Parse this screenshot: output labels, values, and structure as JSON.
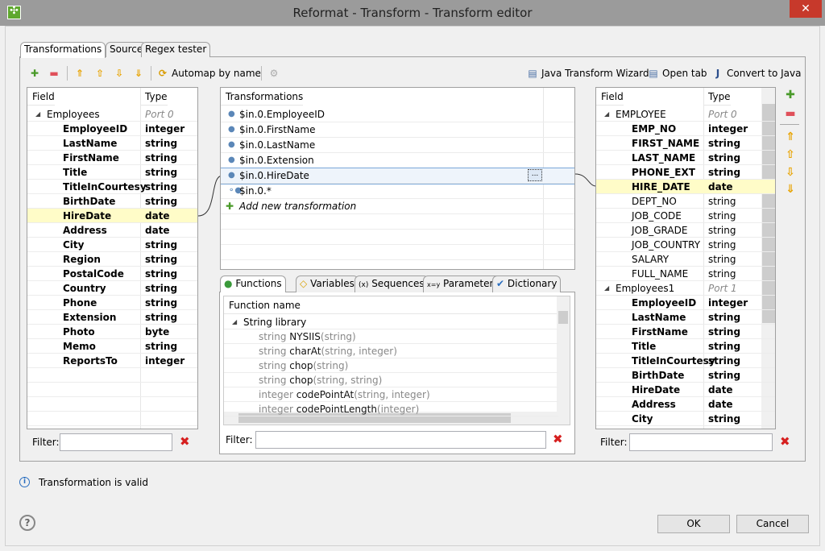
{
  "window": {
    "title": "Reformat - Transform - Transform editor",
    "close": "✕"
  },
  "tabs": [
    "Transformations",
    "Source",
    "Regex tester"
  ],
  "toolbar": {
    "automap": "Automap by name",
    "wizard": "Java Transform Wizard",
    "open_tab": "Open tab",
    "convert": "Convert to Java"
  },
  "source": {
    "col_field": "Field",
    "col_type": "Type",
    "rows": [
      {
        "f": "Employees",
        "t": "Port 0",
        "group": true
      },
      {
        "f": "EmployeeID",
        "t": "integer"
      },
      {
        "f": "LastName",
        "t": "string"
      },
      {
        "f": "FirstName",
        "t": "string"
      },
      {
        "f": "Title",
        "t": "string"
      },
      {
        "f": "TitleInCourtesy",
        "t": "string"
      },
      {
        "f": "BirthDate",
        "t": "string"
      },
      {
        "f": "HireDate",
        "t": "date",
        "hl": true
      },
      {
        "f": "Address",
        "t": "date"
      },
      {
        "f": "City",
        "t": "string"
      },
      {
        "f": "Region",
        "t": "string"
      },
      {
        "f": "PostalCode",
        "t": "string"
      },
      {
        "f": "Country",
        "t": "string"
      },
      {
        "f": "Phone",
        "t": "string"
      },
      {
        "f": "Extension",
        "t": "string"
      },
      {
        "f": "Photo",
        "t": "byte"
      },
      {
        "f": "Memo",
        "t": "string"
      },
      {
        "f": "ReportsTo",
        "t": "integer"
      }
    ],
    "filter_label": "Filter:",
    "filter_value": ""
  },
  "transformations": {
    "header": "Transformations",
    "rows": [
      "$in.0.EmployeeID",
      "$in.0.FirstName",
      "$in.0.LastName",
      "$in.0.Extension",
      "$in.0.HireDate",
      "$in.0.*"
    ],
    "add": "Add new transformation",
    "edit_button": "..."
  },
  "functions": {
    "tabs": [
      "Functions",
      "Variables",
      "Sequences",
      "Parameters",
      "Dictionary"
    ],
    "header": "Function name",
    "group": "String library",
    "rows": [
      {
        "ret": "string",
        "name": "NYSIIS",
        "args": "(string)"
      },
      {
        "ret": "string",
        "name": "charAt",
        "args": "(string, integer)"
      },
      {
        "ret": "string",
        "name": "chop",
        "args": "(string)"
      },
      {
        "ret": "string",
        "name": "chop",
        "args": "(string, string)"
      },
      {
        "ret": "integer",
        "name": "codePointAt",
        "args": "(string, integer)"
      },
      {
        "ret": "integer",
        "name": "codePointLength",
        "args": "(integer)"
      }
    ],
    "filter_label": "Filter:",
    "filter_value": ""
  },
  "target": {
    "col_field": "Field",
    "col_type": "Type",
    "rows": [
      {
        "f": "EMPLOYEE",
        "t": "Port 0",
        "group": true
      },
      {
        "f": "EMP_NO",
        "t": "integer",
        "b": true
      },
      {
        "f": "FIRST_NAME",
        "t": "string",
        "b": true
      },
      {
        "f": "LAST_NAME",
        "t": "string",
        "b": true
      },
      {
        "f": "PHONE_EXT",
        "t": "string",
        "b": true
      },
      {
        "f": "HIRE_DATE",
        "t": "date",
        "b": true,
        "hl": true
      },
      {
        "f": "DEPT_NO",
        "t": "string"
      },
      {
        "f": "JOB_CODE",
        "t": "string"
      },
      {
        "f": "JOB_GRADE",
        "t": "string"
      },
      {
        "f": "JOB_COUNTRY",
        "t": "string"
      },
      {
        "f": "SALARY",
        "t": "string"
      },
      {
        "f": "FULL_NAME",
        "t": "string"
      },
      {
        "f": "Employees1",
        "t": "Port 1",
        "group": true
      },
      {
        "f": "EmployeeID",
        "t": "integer",
        "b": true
      },
      {
        "f": "LastName",
        "t": "string",
        "b": true
      },
      {
        "f": "FirstName",
        "t": "string",
        "b": true
      },
      {
        "f": "Title",
        "t": "string",
        "b": true
      },
      {
        "f": "TitleInCourtesy",
        "t": "string",
        "b": true
      },
      {
        "f": "BirthDate",
        "t": "string",
        "b": true
      },
      {
        "f": "HireDate",
        "t": "date",
        "b": true
      },
      {
        "f": "Address",
        "t": "date",
        "b": true
      },
      {
        "f": "City",
        "t": "string",
        "b": true
      }
    ],
    "filter_label": "Filter:",
    "filter_value": ""
  },
  "status": "Transformation is valid",
  "buttons": {
    "ok": "OK",
    "cancel": "Cancel",
    "help": "?"
  },
  "colors": {
    "highlight": "#fffcc8",
    "close": "#c7392b",
    "add": "#4a9a2a",
    "remove": "#e0505a",
    "arrows": "#e8a300"
  }
}
